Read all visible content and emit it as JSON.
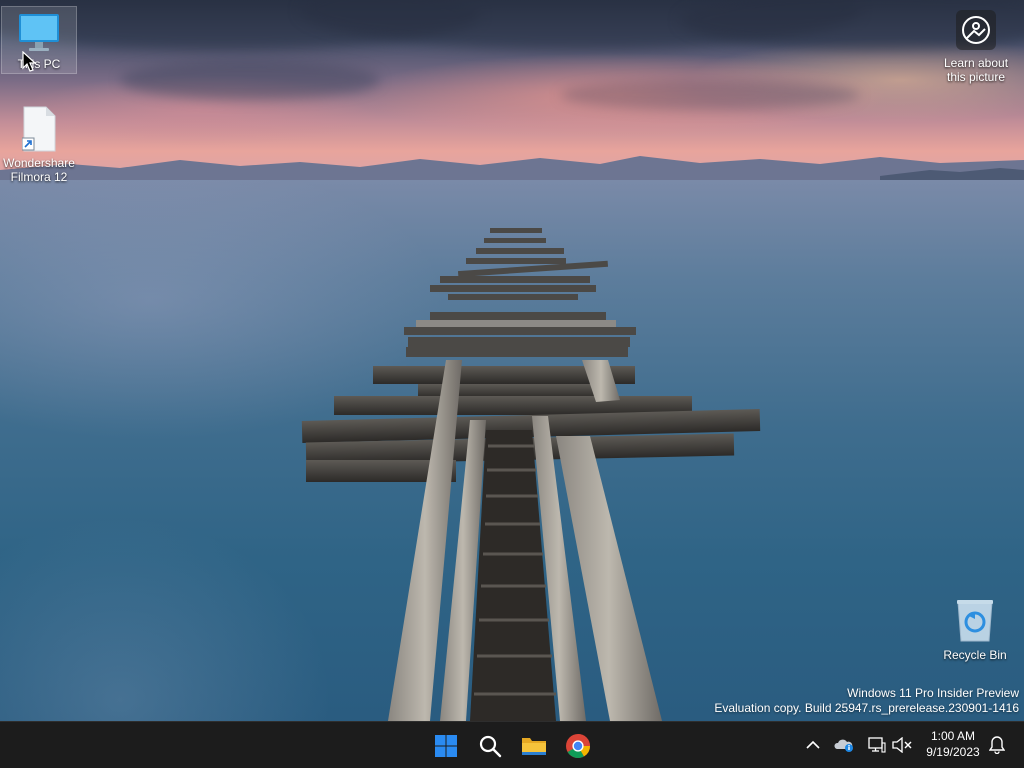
{
  "desktop": {
    "icons": [
      {
        "label": "This PC",
        "icon": "this-pc-icon"
      },
      {
        "label": "Wondershare Filmora 12",
        "icon": "filmora-shortcut-icon"
      },
      {
        "label": "Recycle Bin",
        "icon": "recycle-bin-icon"
      }
    ],
    "spotlight": {
      "label": "Learn about this picture",
      "icon": "camera-spotlight-icon"
    },
    "watermark": {
      "line1": "Windows 11 Pro Insider Preview",
      "line2": "Evaluation copy. Build 25947.rs_prerelease.230901-1416"
    }
  },
  "taskbar": {
    "apps": [
      {
        "name": "Start",
        "icon": "windows-start-icon"
      },
      {
        "name": "Search",
        "icon": "search-icon"
      },
      {
        "name": "File Explorer",
        "icon": "folder-icon"
      },
      {
        "name": "Google Chrome",
        "icon": "chrome-icon"
      }
    ],
    "tray": {
      "icons": [
        "chevron-up-icon",
        "onedrive-icon",
        "network-icon",
        "volume-muted-icon",
        "notification-bell-icon"
      ],
      "time": "1:00 AM",
      "date": "9/19/2023"
    }
  },
  "colors": {
    "taskbar_bg": "#1c1c1c",
    "start_blue": "#2a8bf2",
    "folder_yellow": "#f5c33b"
  }
}
